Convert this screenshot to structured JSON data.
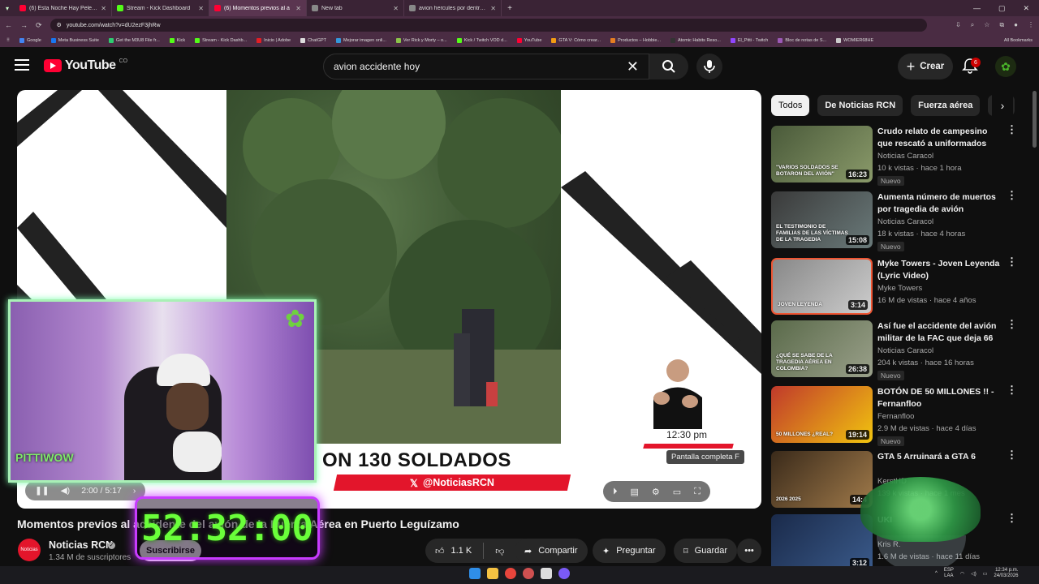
{
  "browser": {
    "tabs": [
      {
        "title": "(6) Esta Noche Hay Pelea - You",
        "color": "#ff0033",
        "active": false
      },
      {
        "title": "Stream - Kick Dashboard",
        "color": "#53fc18",
        "active": false
      },
      {
        "title": "(6) Momentos previos al a",
        "color": "#ff0033",
        "active": true
      },
      {
        "title": "New tab",
        "color": "#888888",
        "active": false
      },
      {
        "title": "avion hercules por dentro - Bus",
        "color": "#888888",
        "active": false
      }
    ],
    "url": "youtube.com/watch?v=dU2ezF3jhRw",
    "bookmarks": [
      {
        "label": "Google",
        "color": "#4285f4"
      },
      {
        "label": "Meta Business Suite",
        "color": "#1877f2"
      },
      {
        "label": "Get the M3U8 File fr...",
        "color": "#2ecc71"
      },
      {
        "label": "Kick",
        "color": "#53fc18"
      },
      {
        "label": "Stream - Kick Dashb...",
        "color": "#53fc18"
      },
      {
        "label": "Inicio | Adobe",
        "color": "#e31e24"
      },
      {
        "label": "ChatGPT",
        "color": "#dddddd"
      },
      {
        "label": "Mejorar imagen onli...",
        "color": "#3498db"
      },
      {
        "label": "Ver Rick y Morty – o...",
        "color": "#8bc34a"
      },
      {
        "label": "Kick / Twitch VOD d...",
        "color": "#53fc18"
      },
      {
        "label": "YouTube",
        "color": "#ff0033"
      },
      {
        "label": "GTA V: Cómo crear...",
        "color": "#f39c12"
      },
      {
        "label": "Productos – Hobbie...",
        "color": "#e67e22"
      },
      {
        "label": "Atomic Habits Reso...",
        "color": "#333333"
      },
      {
        "label": "El_Pitti - Twitch",
        "color": "#9146ff"
      },
      {
        "label": "Bloc de notas de S...",
        "color": "#9b59b6"
      },
      {
        "label": "WOMIER68HE",
        "color": "#cccccc"
      }
    ],
    "all_bookmarks": "All Bookmarks"
  },
  "youtube": {
    "logo_text": "YouTube",
    "country": "CO",
    "search_query": "avion accidente hoy",
    "create_label": "Crear",
    "notifications": "6"
  },
  "player": {
    "ticker_text": "ON 130 SOLDADOS",
    "handle": "@NoticiasRCN",
    "tv_time": "12:30 pm",
    "news_bottom": "NOTICIAS RCN - 12:30 PM",
    "tooltip": "Pantalla completa  F",
    "time_current": "2:00",
    "time_total": "5:17",
    "time_sep": " / ",
    "progress": 0.38
  },
  "overlay": {
    "timer": "52:32:00",
    "brand": "PITTIWOW"
  },
  "video": {
    "title": "Momentos previos al accidente del avión de la Fuerza Aérea en Puerto Leguízamo",
    "channel": "Noticias RCN",
    "channel_logo": "Noticias",
    "subscribers": "1.34 M de suscriptores",
    "subscribe": "Suscribirse",
    "likes": "1.1 K",
    "share": "Compartir",
    "ask": "Preguntar",
    "save": "Guardar"
  },
  "chips": [
    "Todos",
    "De Noticias RCN",
    "Fuerza aérea",
    "No"
  ],
  "recommendations": [
    {
      "title": "Crudo relato de campesino que rescató a uniformados heridos...",
      "channel": "Noticias Caracol",
      "meta": "10 k vistas · hace 1 hora",
      "badge": "Nuevo",
      "duration": "16:23",
      "thumb_text": "\"VARIOS SOLDADOS SE BOTARON DEL AVIÓN\"",
      "c1": "#4a5a3a",
      "c2": "#8a9a6a"
    },
    {
      "title": "Aumenta número de muertos por tragedia de avión Hércules...",
      "channel": "Noticias Caracol",
      "meta": "18 k vistas · hace 4 horas",
      "badge": "Nuevo",
      "duration": "15:08",
      "thumb_text": "EL TESTIMONIO DE FAMILIAS DE LAS VÍCTIMAS DE LA TRAGEDIA",
      "c1": "#3a3a3a",
      "c2": "#6a7a7a"
    },
    {
      "title": "Myke Towers - Joven Leyenda (Lyric Video)",
      "channel": "Myke Towers",
      "meta": "16 M de vistas · hace 4 años",
      "badge": "",
      "duration": "3:14",
      "thumb_text": "JOVEN LEYENDA",
      "c1": "#888888",
      "c2": "#cccccc"
    },
    {
      "title": "Así fue el accidente del avión militar de la FAC que deja 66 ...",
      "channel": "Noticias Caracol",
      "meta": "204 k vistas · hace 16 horas",
      "badge": "Nuevo",
      "duration": "26:38",
      "thumb_text": "¿QUÉ SE SABE DE LA TRAGEDIA AÉREA EN COLOMBIA?",
      "c1": "#5a6a4a",
      "c2": "#9aa08a"
    },
    {
      "title": "BOTÓN DE 50 MILLONES !! - Fernanfloo",
      "channel": "Fernanfloo",
      "meta": "2.9 M de vistas · hace 4 días",
      "badge": "Nuevo",
      "duration": "19:14",
      "thumb_text": "50 MILLONES ¿REAL?",
      "c1": "#c0392b",
      "c2": "#f1c40f"
    },
    {
      "title": "GTA 5 Arruinará a GTA 6",
      "channel": "KerstHD",
      "meta": "139 k vistas · hace 1 mes",
      "badge": "",
      "duration": "14:4",
      "thumb_text": "2026 2025",
      "c1": "#3a2a1a",
      "c2": "#a07a4a"
    },
    {
      "title": "UKI",
      "channel": "Kris R.",
      "meta": "1.6 M de vistas · hace 11 días",
      "badge": "",
      "duration": "3:12",
      "thumb_text": "",
      "c1": "#1a2a4a",
      "c2": "#3a5a8a"
    }
  ],
  "taskbar": {
    "lang": "ESP",
    "lang2": "LAA",
    "time": "12:34 p.m.",
    "date": "24/03/2026"
  }
}
